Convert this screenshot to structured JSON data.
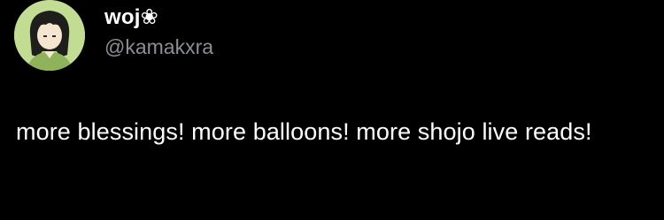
{
  "author": {
    "display_name": "woj❀",
    "handle": "@kamakxra",
    "avatar_icon": "profile-picture-anime-girl"
  },
  "tweet": {
    "text": "more blessings! more balloons! more shojo live reads!"
  },
  "colors": {
    "background": "#000000",
    "text": "#ffffff",
    "handle": "#8b8f94",
    "avatar_bg": "#b9d58a"
  }
}
